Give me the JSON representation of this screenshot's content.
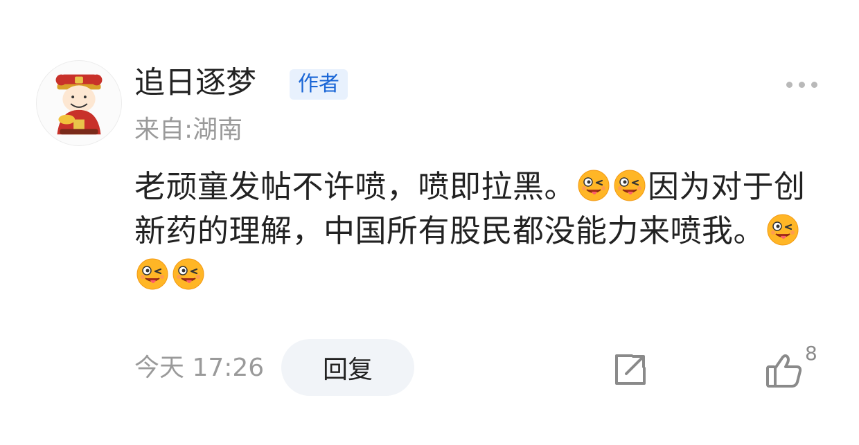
{
  "comment_card": {
    "username": "追日逐梦",
    "author_badge": "作者",
    "location": "来自:湖南",
    "content": [
      {
        "type": "text",
        "value": "老顽童发帖不许喷，喷即拉黑。"
      },
      {
        "type": "emoji",
        "name": "winking-tongue-emoji"
      },
      {
        "type": "emoji",
        "name": "winking-tongue-emoji"
      },
      {
        "type": "text",
        "value": "因为对于创新药的理解，中国所有股民都没能力来喷我。"
      },
      {
        "type": "emoji",
        "name": "winking-tongue-emoji"
      },
      {
        "type": "emoji",
        "name": "winking-tongue-emoji"
      },
      {
        "type": "emoji",
        "name": "winking-tongue-emoji"
      }
    ],
    "timestamp": "今天 17:26",
    "reply_label": "回复",
    "like_count": "8"
  },
  "icons": {
    "avatar": "caishen-avatar",
    "more": "more-dots-icon",
    "share": "share-icon",
    "like": "thumbs-up-icon"
  },
  "colors": {
    "badge_bg": "#e8f1fd",
    "badge_text": "#1a66d6",
    "muted_text": "#9a9a9a",
    "main_text": "#222222",
    "reply_bg": "#f1f4f8"
  }
}
